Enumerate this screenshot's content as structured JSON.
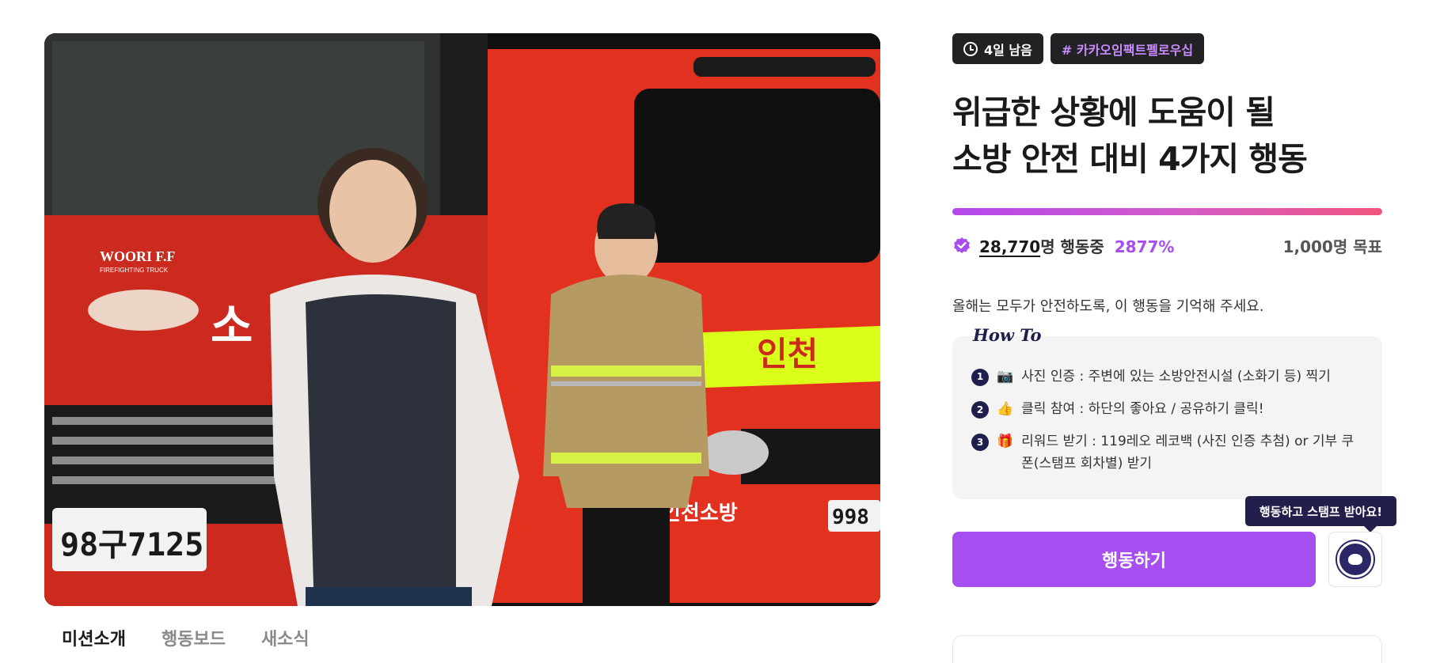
{
  "hero": {
    "truck_brand": "WOORI F.F",
    "truck_brand_sub": "FIREFIGHTING TRUCK",
    "plate_left": "98구7125",
    "plate_right": "998",
    "door_text": "소",
    "right_truck_stripe": "인천",
    "right_truck_bumper": "인천소방"
  },
  "tabs": [
    {
      "label": "미션소개",
      "active": true
    },
    {
      "label": "행동보드",
      "active": false
    },
    {
      "label": "새소식",
      "active": false
    }
  ],
  "chips": {
    "days_left": "4일 남음",
    "hashtag": "# 카카오임팩트펠로우십"
  },
  "title": {
    "line1": "위급한 상황에 도움이 될",
    "line2": "소방 안전 대비 4가지 행동"
  },
  "progress": {
    "percent_value": 2877,
    "fill_fraction": 1.0
  },
  "stats": {
    "count": "28,770",
    "count_suffix": "명 행동중",
    "percent": "2877%",
    "goal": "1,000명 목표"
  },
  "subtitle": "올해는 모두가 안전하도록, 이 행동을 기억해 주세요.",
  "howto": {
    "title": "How To",
    "steps": [
      {
        "num": "1",
        "emoji": "📷",
        "text": "사진 인증 : 주변에 있는 소방안전시설 (소화기 등) 찍기"
      },
      {
        "num": "2",
        "emoji": "👍",
        "text": "클릭 참여 : 하단의 좋아요 / 공유하기 클릭!"
      },
      {
        "num": "3",
        "emoji": "🎁",
        "text": "리워드 받기 : 119레오 레코백 (사진 인증 추첨) or 기부 쿠폰(스탬프 회차별) 받기"
      }
    ]
  },
  "tooltip": "행동하고 스탬프 받아요!",
  "cta": "행동하기",
  "colors": {
    "accent": "#a64ef0",
    "chip_bg": "#222224",
    "navy": "#1f1f4d",
    "gradient_start": "#b347ec",
    "gradient_end": "#f1557f"
  }
}
